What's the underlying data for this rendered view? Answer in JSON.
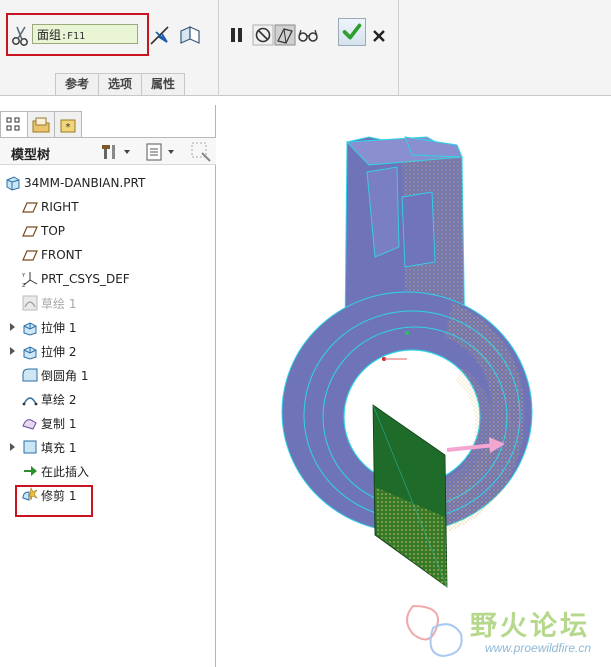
{
  "dashboard": {
    "quilt_field": {
      "label": "面组",
      "value": ":F11"
    },
    "tabs": [
      "参考",
      "选项",
      "属性"
    ]
  },
  "model_tree": {
    "title": "模型树",
    "items": [
      {
        "label": "34MM-DANBIAN.PRT",
        "icon": "part-icon",
        "expandable": false,
        "dimmed": false
      },
      {
        "label": "RIGHT",
        "icon": "datum-plane-icon",
        "expandable": false,
        "dimmed": false
      },
      {
        "label": "TOP",
        "icon": "datum-plane-icon",
        "expandable": false,
        "dimmed": false
      },
      {
        "label": "FRONT",
        "icon": "datum-plane-icon",
        "expandable": false,
        "dimmed": false
      },
      {
        "label": "PRT_CSYS_DEF",
        "icon": "csys-icon",
        "expandable": false,
        "dimmed": false
      },
      {
        "label": "草绘 1",
        "icon": "sketch-icon",
        "expandable": false,
        "dimmed": true
      },
      {
        "label": "拉伸 1",
        "icon": "extrude-icon",
        "expandable": true,
        "dimmed": false
      },
      {
        "label": "拉伸 2",
        "icon": "extrude-icon",
        "expandable": true,
        "dimmed": false
      },
      {
        "label": "倒圆角 1",
        "icon": "round-icon",
        "expandable": false,
        "dimmed": false
      },
      {
        "label": "草绘 2",
        "icon": "sketch-icon",
        "expandable": false,
        "dimmed": false
      },
      {
        "label": "复制 1",
        "icon": "copy-icon",
        "expandable": false,
        "dimmed": false
      },
      {
        "label": "填充 1",
        "icon": "fill-icon",
        "expandable": true,
        "dimmed": false
      },
      {
        "label": "在此插入",
        "icon": "insert-here-icon",
        "expandable": false,
        "dimmed": false
      },
      {
        "label": "修剪 1",
        "icon": "trim-icon",
        "expandable": false,
        "dimmed": false
      }
    ]
  },
  "watermark": {
    "text": "野火论坛",
    "url": "www.proewildfire.cn"
  },
  "colors": {
    "part_body": "#7b7fc0",
    "edge": "#2fd4e6",
    "fill_surface": "#1f6b2a",
    "highlight_box": "#c8141e",
    "quilt_field_bg": "#eaf5d6",
    "ok_check": "#2e9f2e"
  }
}
